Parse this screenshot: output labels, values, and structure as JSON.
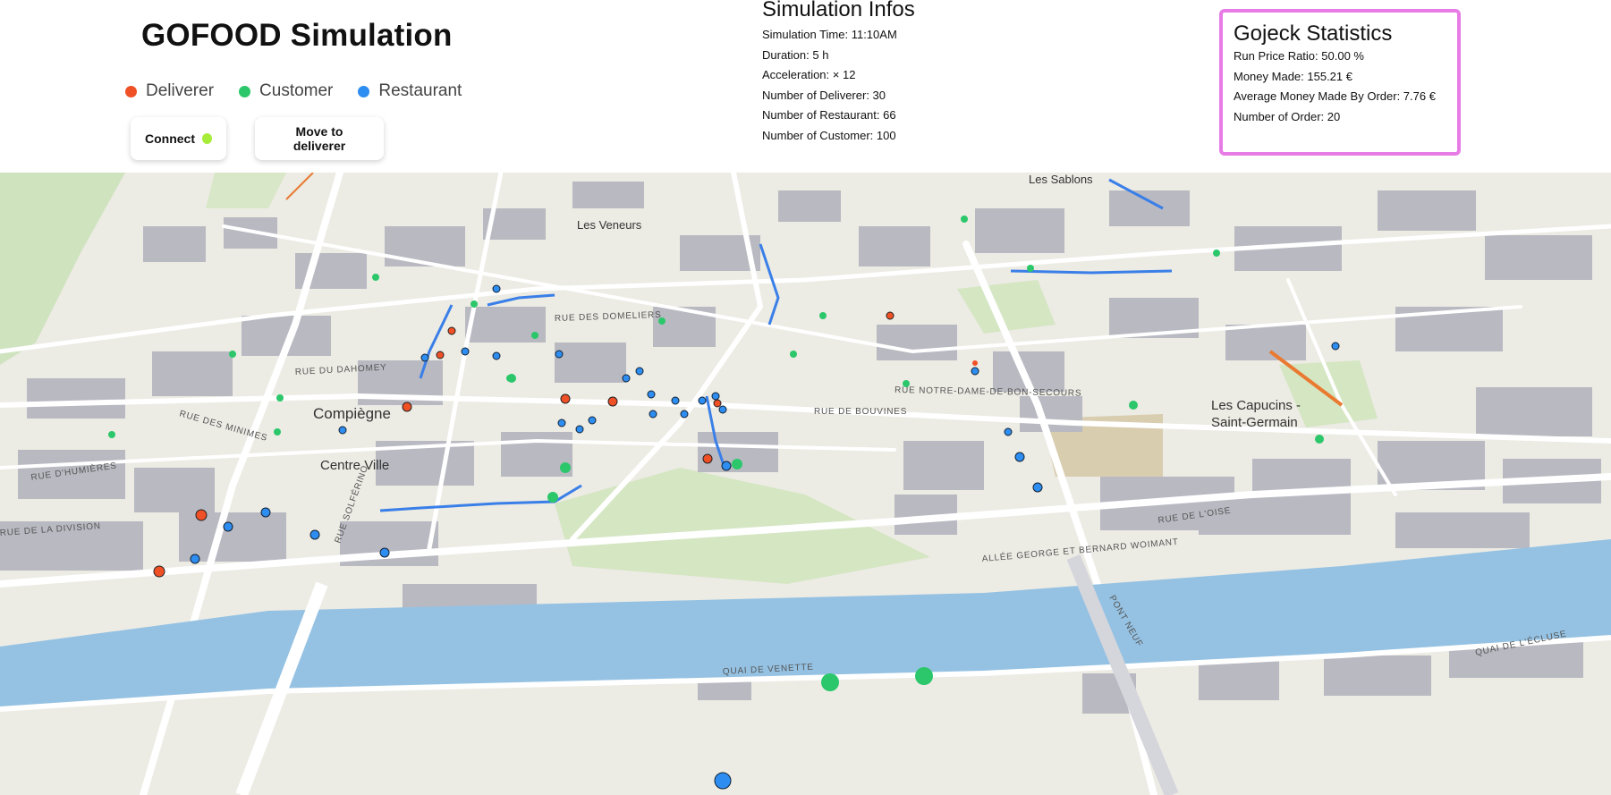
{
  "header": {
    "title": "GOFOOD Simulation",
    "legend": [
      {
        "label": "Deliverer",
        "color": "#f05025"
      },
      {
        "label": "Customer",
        "color": "#2bc76a"
      },
      {
        "label": "Restaurant",
        "color": "#2e8df0"
      }
    ],
    "buttons": {
      "connect_label": "Connect",
      "connect_status_color": "#a8ec3a",
      "move_label": "Move to deliverer"
    }
  },
  "simulation_info": {
    "title": "Simulation Infos",
    "lines": [
      "Simulation Time: 11:10AM",
      "Duration: 5 h",
      "Acceleration: × 12",
      "Number of Deliverer: 30",
      "Number of Restaurant: 66",
      "Number of Customer: 100"
    ]
  },
  "statistics": {
    "title": "Gojeck Statistics",
    "lines": [
      "Run Price Ratio: 50.00 %",
      "Money Made: 155.21 €",
      "Average Money Made By Order: 7.76 €",
      "Number of Order: 20"
    ],
    "border_color": "#e77ce6"
  },
  "map": {
    "place_labels": [
      "Les Sablons",
      "Les Veneurs",
      "Compiègne",
      "Centre Ville",
      "Les Capucins -",
      "Saint-Germain"
    ],
    "street_labels": [
      "RUE DES DOMELIERS",
      "RUE DU DAHOMEY",
      "RUE DES MINIMES",
      "RUE D'HUMIÈRES",
      "RUE DE LA DIVISION",
      "RUE SOLFÉRINO",
      "RUE NOTRE-DAME-DE-BON-SECOURS",
      "RUE DE BOUVINES",
      "RUE DE L'OISE",
      "ALLÉE GEORGE ET BERNARD WOIMANT",
      "PONT NEUF",
      "QUAI DE VENETTE",
      "QUAI DE L'ÉCLUSE"
    ],
    "colors": {
      "water": "#95c2e3",
      "land": "#ecebe4",
      "park": "#cfe3bf",
      "building": "#b9b9c2",
      "road": "#ffffff"
    }
  }
}
